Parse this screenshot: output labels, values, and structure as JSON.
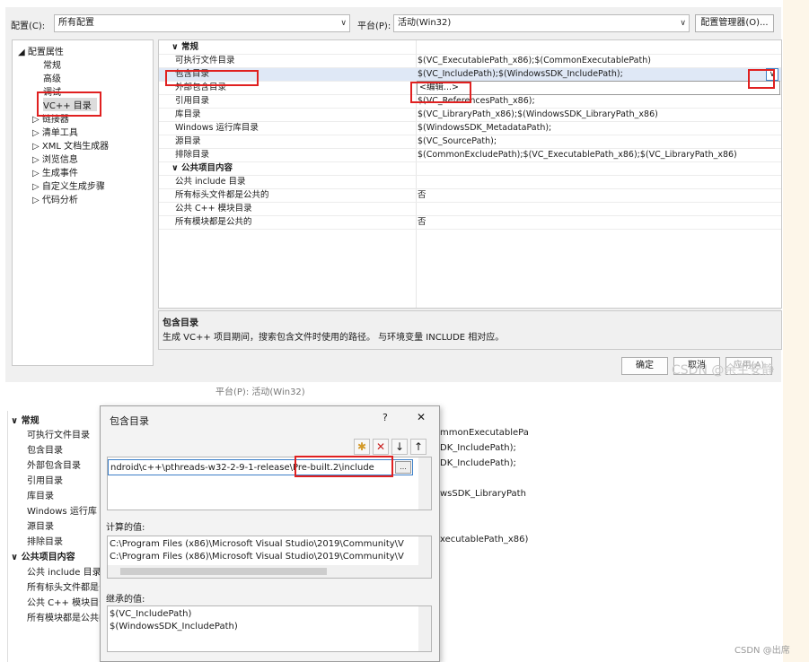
{
  "top": {
    "config_label": "配置(C):",
    "config_value": "所有配置",
    "platform_label": "平台(P):",
    "platform_value": "活动(Win32)",
    "config_manager": "配置管理器(O)...",
    "tree": [
      {
        "label": "◢ 配置属性"
      },
      {
        "label": "常规"
      },
      {
        "label": "高级"
      },
      {
        "label": "调试"
      },
      {
        "label": "VC++ 目录"
      },
      {
        "label": "▷ 链接器"
      },
      {
        "label": "▷ 清单工具"
      },
      {
        "label": "▷ XML 文档生成器"
      },
      {
        "label": "▷ 浏览信息"
      },
      {
        "label": "▷ 生成事件"
      },
      {
        "label": "▷ 自定义生成步骤"
      },
      {
        "label": "▷ 代码分析"
      }
    ],
    "grid": [
      {
        "k": "∨  常规",
        "v": "",
        "cat": true
      },
      {
        "k": "可执行文件目录",
        "v": "$(VC_ExecutablePath_x86);$(CommonExecutablePath)"
      },
      {
        "k": "包含目录",
        "v": "$(VC_IncludePath);$(WindowsSDK_IncludePath);"
      },
      {
        "k": "外部包含目录",
        "v": "<编辑...>"
      },
      {
        "k": "引用目录",
        "v": "$(VC_ReferencesPath_x86);"
      },
      {
        "k": "库目录",
        "v": "$(VC_LibraryPath_x86);$(WindowsSDK_LibraryPath_x86)"
      },
      {
        "k": "Windows 运行库目录",
        "v": "$(WindowsSDK_MetadataPath);"
      },
      {
        "k": "源目录",
        "v": "$(VC_SourcePath);"
      },
      {
        "k": "排除目录",
        "v": "$(CommonExcludePath);$(VC_ExecutablePath_x86);$(VC_LibraryPath_x86)"
      },
      {
        "k": "∨  公共项目内容",
        "v": "",
        "cat": true
      },
      {
        "k": "公共 include 目录",
        "v": ""
      },
      {
        "k": "所有标头文件都是公共的",
        "v": "否"
      },
      {
        "k": "公共 C++ 模块目录",
        "v": ""
      },
      {
        "k": "所有模块都是公共的",
        "v": "否"
      }
    ],
    "desc_title": "包含目录",
    "desc_text": "生成 VC++ 项目期间，搜索包含文件时使用的路径。 与环境变量 INCLUDE 相对应。",
    "ok": "确定",
    "cancel": "取消",
    "apply": "应用(A)",
    "watermark": "CSDN @余生安静"
  },
  "bottom": {
    "cut_header": "平台(P):  活动(Win32)",
    "grid": [
      {
        "k": "∨  常规",
        "cat": true
      },
      {
        "k": "可执行文件目录",
        "v": "mmonExecutablePa"
      },
      {
        "k": "包含目录",
        "v": "DK_IncludePath);"
      },
      {
        "k": "外部包含目录",
        "v": "DK_IncludePath);"
      },
      {
        "k": "引用目录",
        "v": ""
      },
      {
        "k": "库目录",
        "v": "wsSDK_LibraryPath"
      },
      {
        "k": "Windows 运行库",
        "v": ""
      },
      {
        "k": "源目录",
        "v": ""
      },
      {
        "k": "排除目录",
        "v": "xecutablePath_x86)"
      },
      {
        "k": "∨  公共项目内容",
        "cat": true
      },
      {
        "k": "公共 include 目录",
        "v": ""
      },
      {
        "k": "所有标头文件都是公共的",
        "v": ""
      },
      {
        "k": "公共 C++ 模块目录",
        "v": ""
      },
      {
        "k": "所有模块都是公共的",
        "v": ""
      }
    ],
    "dialog": {
      "title": "包含目录",
      "help": "?",
      "close": "✕",
      "entry": "ndroid\\c++\\pthreads-w32-2-9-1-release\\Pre-built.2\\include",
      "ellipsis": "...",
      "computed_label": "计算的值:",
      "computed": [
        "C:\\Program Files (x86)\\Microsoft Visual Studio\\2019\\Community\\V",
        "C:\\Program Files (x86)\\Microsoft Visual Studio\\2019\\Community\\V"
      ],
      "inherited_label": "继承的值:",
      "inherited": [
        "$(VC_IncludePath)",
        "$(WindowsSDK_IncludePath)"
      ]
    },
    "watermark": "CSDN @出席"
  }
}
